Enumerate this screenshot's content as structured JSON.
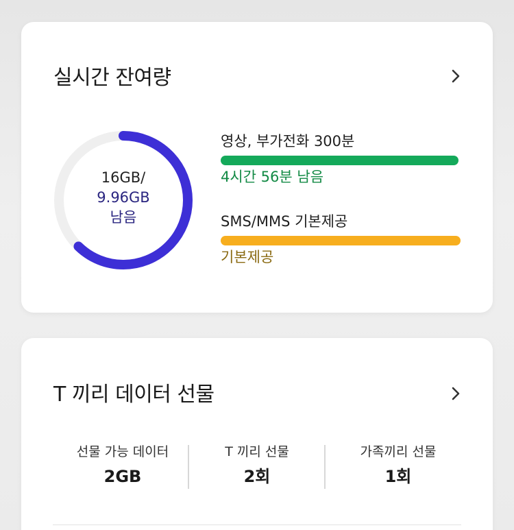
{
  "remaining": {
    "title": "실시간 잔여량",
    "data_total": "16GB/",
    "data_remaining": "9.96GB",
    "data_suffix": "남음",
    "data_remaining_fraction": 0.6225,
    "ring_color": "#3d2fd6",
    "ring_track_color": "#efefef",
    "voice": {
      "label": "영상, 부가전화 300분",
      "status": "4시간 56분 남음",
      "bar_color": "#14a95a",
      "status_color": "#138a45",
      "fill_fraction": 1.0
    },
    "sms": {
      "label": "SMS/MMS 기본제공",
      "status": "기본제공",
      "bar_color": "#f7ae1e",
      "status_color": "#8a6a12",
      "fill_fraction": 1.0
    }
  },
  "gift": {
    "title": "T 끼리 데이터 선물",
    "stats": [
      {
        "label": "선물 가능 데이터",
        "value": "2GB"
      },
      {
        "label": "T 끼리 선물",
        "value": "2회"
      },
      {
        "label": "가족끼리 선물",
        "value": "1회"
      }
    ]
  },
  "icons": {
    "chevron": "chevron-right-icon"
  }
}
